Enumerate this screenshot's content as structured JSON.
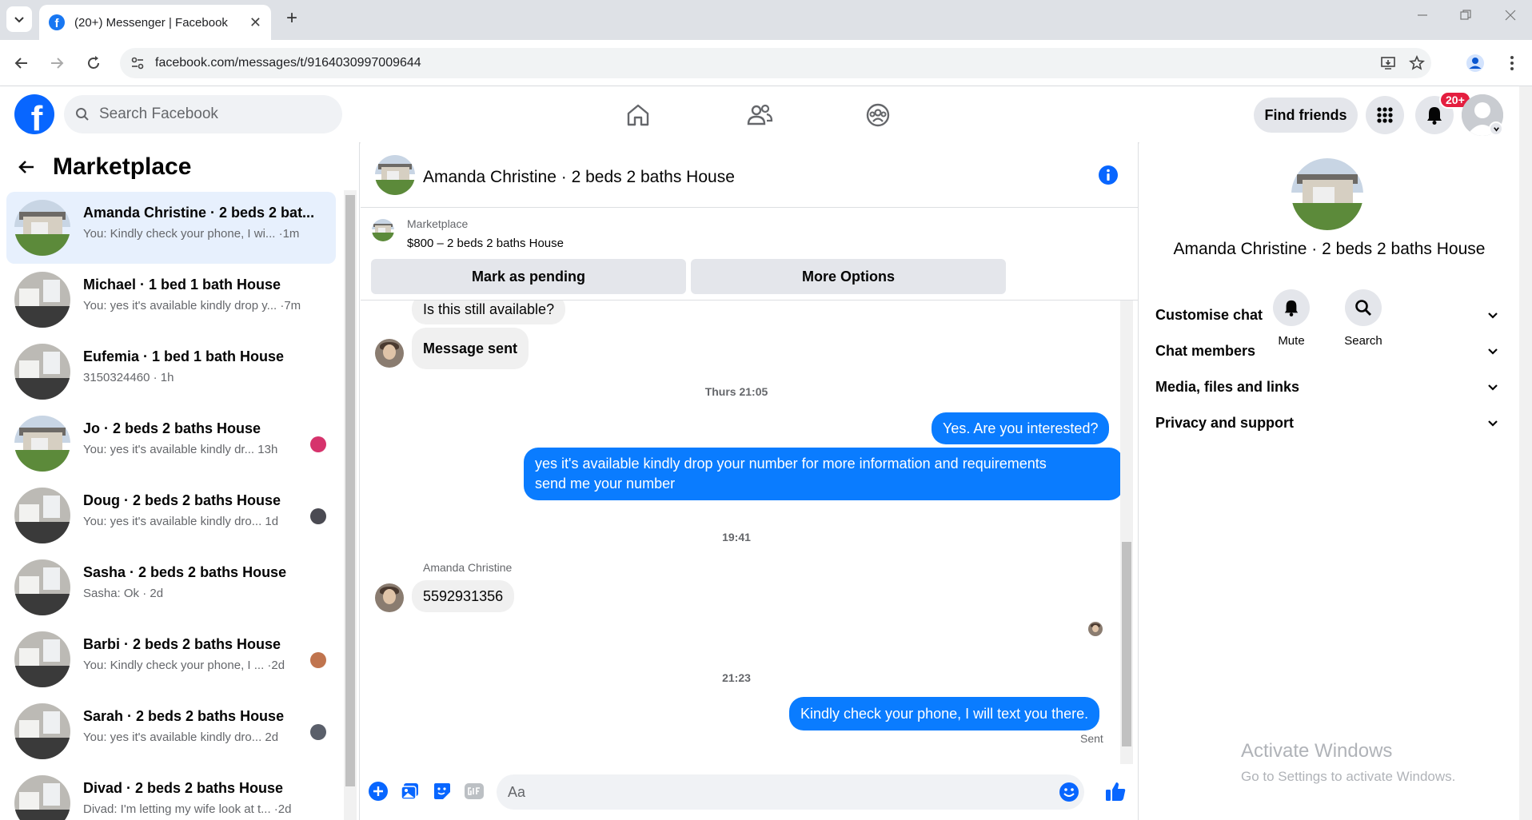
{
  "browser": {
    "tab_title": "(20+) Messenger | Facebook",
    "url": "facebook.com/messages/t/9164030997009644",
    "new_tab": "+",
    "close": "✕"
  },
  "fb": {
    "logo_letter": "f",
    "search_placeholder": "Search Facebook",
    "find_friends": "Find friends",
    "notification_badge": "20+"
  },
  "sidebar": {
    "title": "Marketplace",
    "conversations": [
      {
        "name": "Amanda Christine · 2 beds 2 bat...",
        "preview": "You: Kindly check your phone, I wi... ·1m",
        "photo": "house",
        "active": true
      },
      {
        "name": "Michael · 1 bed 1 bath House",
        "preview": "You: yes it's available kindly drop y... ·7m",
        "photo": "room"
      },
      {
        "name": "Eufemia · 1 bed 1 bath House",
        "preview": "3150324460 · 1h",
        "photo": "room"
      },
      {
        "name": "Jo · 2 beds 2 baths House",
        "preview": "You: yes it's available kindly dr...  13h",
        "photo": "house",
        "mini": "#d6336c"
      },
      {
        "name": "Doug · 2 beds 2 baths House",
        "preview": "You: yes it's available kindly dro...  1d",
        "photo": "room",
        "mini": "#4a4a52"
      },
      {
        "name": "Sasha · 2 beds 2 baths House",
        "preview": "Sasha: Ok · 2d",
        "photo": "room"
      },
      {
        "name": "Barbi · 2 beds 2 baths House",
        "preview": "You: Kindly check your phone, I ... ·2d",
        "photo": "room",
        "mini": "#c0744e"
      },
      {
        "name": "Sarah · 2 beds 2 baths House",
        "preview": "You: yes it's available kindly dro...  2d",
        "photo": "room",
        "mini": "#5a5f6a"
      },
      {
        "name": "Divad · 2 beds 2 baths House",
        "preview": "Divad: I'm letting my wife look at t... ·2d",
        "photo": "room"
      }
    ]
  },
  "chat": {
    "title": "Amanda Christine · 2 beds 2 baths House",
    "marketplace_label": "Marketplace",
    "listing": "$800 – 2 beds 2 baths House",
    "mark_pending": "Mark as pending",
    "more_options": "More Options",
    "messages": {
      "m1": "Is this still available?",
      "m2": "Message sent",
      "time1": "Thurs 21:05",
      "m3": "Yes. Are you interested?",
      "m4_line1": "yes it's available kindly drop your number for more information and requirements",
      "m4_line2": "send me your number",
      "time2": "19:41",
      "sender": "Amanda Christine",
      "m5": "5592931356",
      "time3": "21:23",
      "m6": "Kindly check your phone, I will text you there.",
      "status": "Sent"
    },
    "composer_placeholder": "Aa"
  },
  "details": {
    "name": "Amanda Christine · 2 beds 2 baths House",
    "mute": "Mute",
    "search": "Search",
    "sections": [
      "Customise chat",
      "Chat members",
      "Media, files and links",
      "Privacy and support"
    ]
  },
  "watermark": {
    "line1": "Activate Windows",
    "line2": "Go to Settings to activate Windows."
  },
  "colors": {
    "brand": "#0866ff",
    "outgoing_bubble": "#0a7cff",
    "badge": "#e41e3f"
  }
}
